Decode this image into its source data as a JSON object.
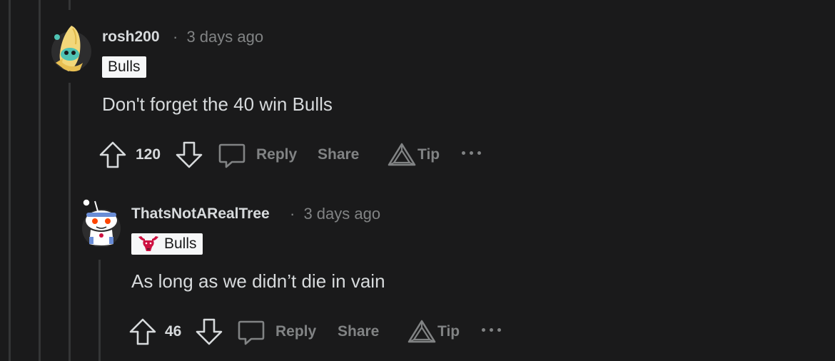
{
  "comments": [
    {
      "username": "rosh200",
      "separator": "·",
      "time": "3 days ago",
      "flair": "Bulls",
      "body": "Don't forget the 40 win Bulls",
      "votes": "120",
      "actions": {
        "reply": "Reply",
        "share": "Share",
        "tip": "Tip"
      }
    },
    {
      "username": "ThatsNotARealTree",
      "separator": "·",
      "time": "3 days ago",
      "flair": "Bulls",
      "body": "As long as we didn’t die in vain",
      "votes": "46",
      "actions": {
        "reply": "Reply",
        "share": "Share",
        "tip": "Tip"
      }
    }
  ],
  "icons": {
    "upvote": "arrow-up-outline-icon",
    "downvote": "arrow-down-outline-icon",
    "reply": "speech-bubble-icon",
    "tip": "triangle-tip-icon",
    "more": "horizontal-ellipsis-icon",
    "flair_logo": "bulls-logo-icon"
  },
  "colors": {
    "background": "#1a1a1b",
    "thread_line": "#343536",
    "text_primary": "#d7dadc",
    "text_muted": "#818384",
    "flair_bg": "#f6f7f8",
    "bulls_red": "#ce1141"
  }
}
